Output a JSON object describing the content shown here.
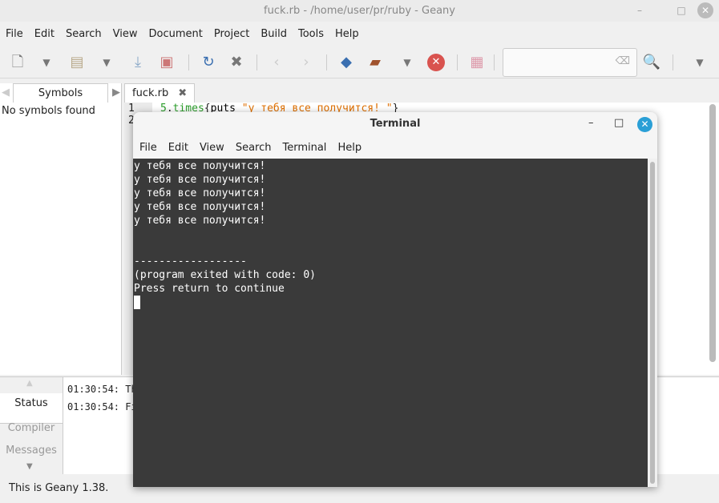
{
  "window": {
    "title": "fuck.rb - /home/user/pr/ruby - Geany"
  },
  "menu": [
    "File",
    "Edit",
    "Search",
    "View",
    "Document",
    "Project",
    "Build",
    "Tools",
    "Help"
  ],
  "sidebar": {
    "tab": "Symbols",
    "empty": "No symbols found"
  },
  "editor": {
    "tab": "fuck.rb",
    "lines": [
      "1",
      "2"
    ],
    "code": {
      "num": "5",
      "dot": ".",
      "method": "times",
      "brace": "{",
      "kw": "puts",
      "str": "\"у тебя все получится! \"",
      "close": "}"
    }
  },
  "messages": {
    "tabs": [
      "Status",
      "Compiler",
      "Messages"
    ],
    "log": [
      "01:30:54: Th",
      "01:30:54: Fi"
    ]
  },
  "statusbar": "This is Geany 1.38.",
  "terminal": {
    "title": "Terminal",
    "menu": [
      "File",
      "Edit",
      "View",
      "Search",
      "Terminal",
      "Help"
    ],
    "lines": [
      "у тебя все получится!",
      "у тебя все получится!",
      "у тебя все получится!",
      "у тебя все получится!",
      "у тебя все получится!",
      "",
      "",
      "------------------",
      "(program exited with code: 0)",
      "Press return to continue"
    ]
  }
}
